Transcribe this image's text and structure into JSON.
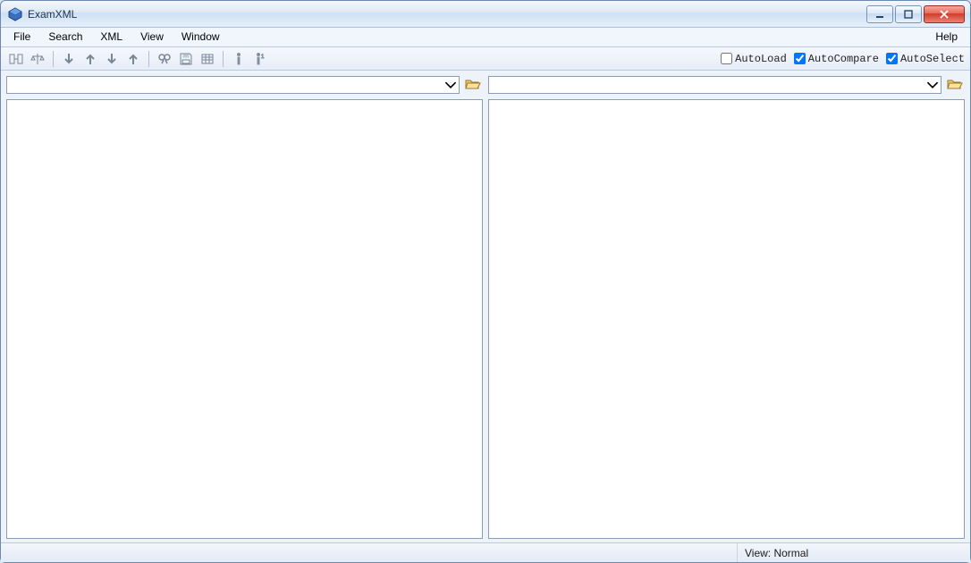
{
  "window": {
    "title": "ExamXML"
  },
  "menu": {
    "file": "File",
    "search": "Search",
    "xml": "XML",
    "view": "View",
    "window": "Window",
    "help": "Help"
  },
  "toolbar": {
    "checkboxes": {
      "autoload": {
        "label": "AutoLoad",
        "checked": false
      },
      "autocompare": {
        "label": "AutoCompare",
        "checked": true
      },
      "autoselect": {
        "label": "AutoSelect",
        "checked": true
      }
    }
  },
  "file_slots": {
    "left": {
      "value": ""
    },
    "right": {
      "value": ""
    }
  },
  "statusbar": {
    "left": "",
    "view": "View: Normal"
  }
}
